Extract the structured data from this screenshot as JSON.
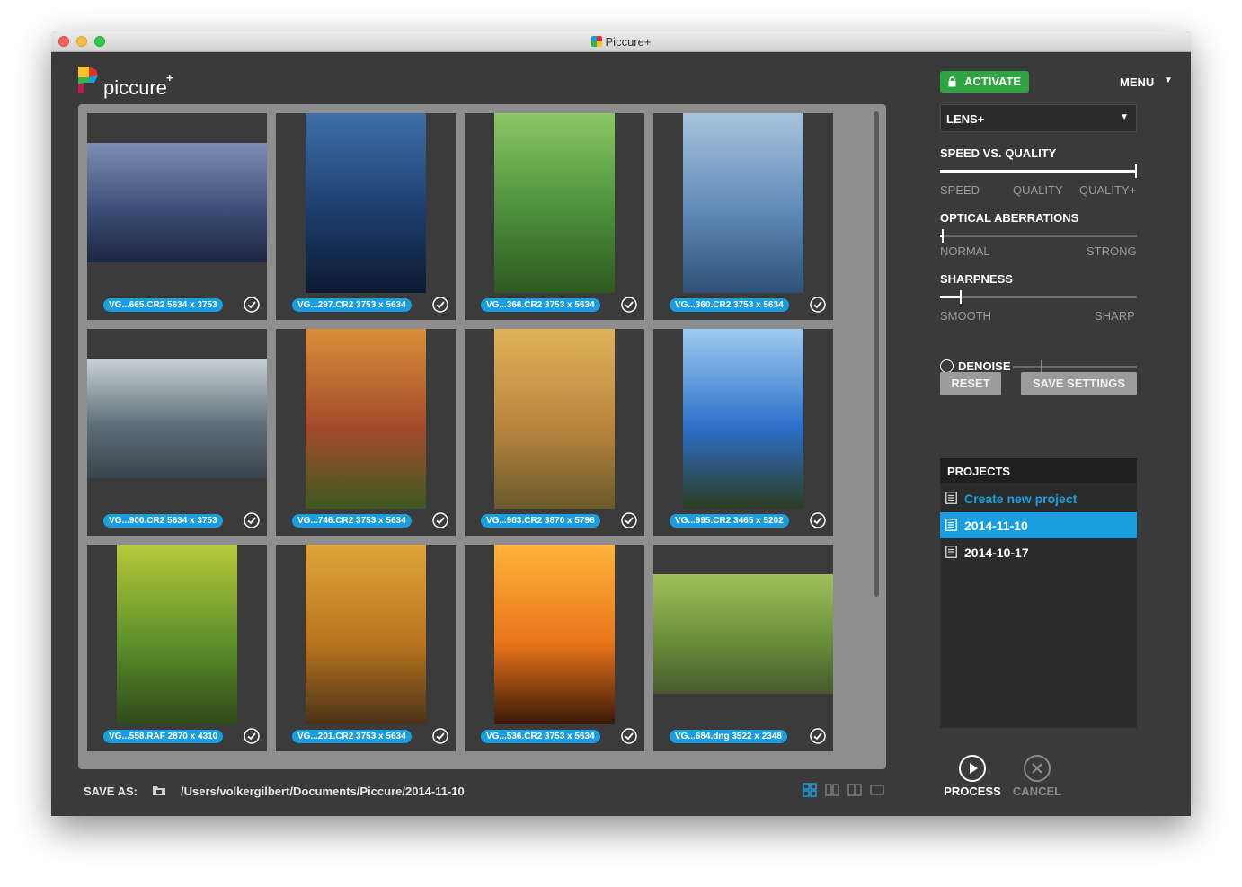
{
  "window": {
    "title": "Piccure+"
  },
  "logo": {
    "text": "piccure",
    "sup": "+"
  },
  "gallery": {
    "images": [
      {
        "label": "VG...665.CR2 5634 x 3753",
        "orientation": "landscape",
        "colors": [
          "#3c4f78",
          "#7b8fb5",
          "#1e2640"
        ]
      },
      {
        "label": "VG...297.CR2 3753 x 5634",
        "orientation": "portrait",
        "colors": [
          "#1d3d6e",
          "#3e6fa8",
          "#0c1a30"
        ]
      },
      {
        "label": "VG...366.CR2 3753 x 5634",
        "orientation": "portrait",
        "colors": [
          "#4c8f3a",
          "#8ac765",
          "#2d5a20"
        ]
      },
      {
        "label": "VG...360.CR2 3753 x 5634",
        "orientation": "portrait",
        "colors": [
          "#5f8ab8",
          "#a7c3de",
          "#2e5176"
        ]
      },
      {
        "label": "VG...900.CR2 5634 x 3753",
        "orientation": "landscape",
        "colors": [
          "#5f6f7a",
          "#c9d3d6",
          "#3a444c"
        ]
      },
      {
        "label": "VG...746.CR2 3753 x 5634",
        "orientation": "portrait",
        "colors": [
          "#a44a2a",
          "#d88f3a",
          "#3e5a22"
        ]
      },
      {
        "label": "VG...983.CR2 3870 x 5796",
        "orientation": "portrait",
        "colors": [
          "#b9853e",
          "#e0b25a",
          "#6a5a2a"
        ]
      },
      {
        "label": "VG...995.CR2 3465 x 5202",
        "orientation": "portrait",
        "colors": [
          "#2d6fc9",
          "#9ecbf0",
          "#2b3d22"
        ]
      },
      {
        "label": "VG...558.RAF 2870 x 4310",
        "orientation": "portrait",
        "colors": [
          "#5c8f2a",
          "#b8c93a",
          "#2f4a1a"
        ]
      },
      {
        "label": "VG...201.CR2 3753 x 5634",
        "orientation": "portrait",
        "colors": [
          "#b9751e",
          "#e0a43a",
          "#4a3216"
        ]
      },
      {
        "label": "VG...536.CR2 3753 x 5634",
        "orientation": "portrait",
        "colors": [
          "#e8741a",
          "#ffb43a",
          "#3a1808"
        ]
      },
      {
        "label": "VG...684.dng 3522 x 2348",
        "orientation": "landscape",
        "colors": [
          "#6a8f3a",
          "#a0c05a",
          "#4a5a30"
        ]
      }
    ]
  },
  "footer": {
    "save_as_label": "SAVE AS:",
    "path": "/Users/volkergilbert/Documents/Piccure/2014-11-10"
  },
  "sidebar": {
    "activate_label": "ACTIVATE",
    "menu_label": "MENU",
    "mode_select_value": "LENS+",
    "speed_quality": {
      "title": "SPEED VS. QUALITY",
      "labels": [
        "SPEED",
        "QUALITY",
        "QUALITY+"
      ],
      "value": 1.0
    },
    "optical": {
      "title": "OPTICAL ABERRATIONS",
      "min_label": "NORMAL",
      "max_label": "STRONG",
      "value": 0.01
    },
    "sharpness": {
      "title": "SHARPNESS",
      "min_label": "SMOOTH",
      "max_label": "SHARP",
      "value": 0.1
    },
    "denoise": {
      "label": "DENOISE",
      "enabled": false,
      "value": 0.23
    },
    "reset_label": "RESET",
    "save_settings_label": "SAVE SETTINGS",
    "projects": {
      "title": "PROJECTS",
      "create_label": "Create new project",
      "items": [
        {
          "label": "2014-11-10",
          "selected": true
        },
        {
          "label": "2014-10-17",
          "selected": false
        }
      ]
    },
    "process_label": "PROCESS",
    "cancel_label": "CANCEL"
  },
  "colors": {
    "accent": "#1a9ee0",
    "activate": "#2ea442",
    "panel": "#3a3a3a",
    "gallery_bg": "#8e8e8e"
  }
}
